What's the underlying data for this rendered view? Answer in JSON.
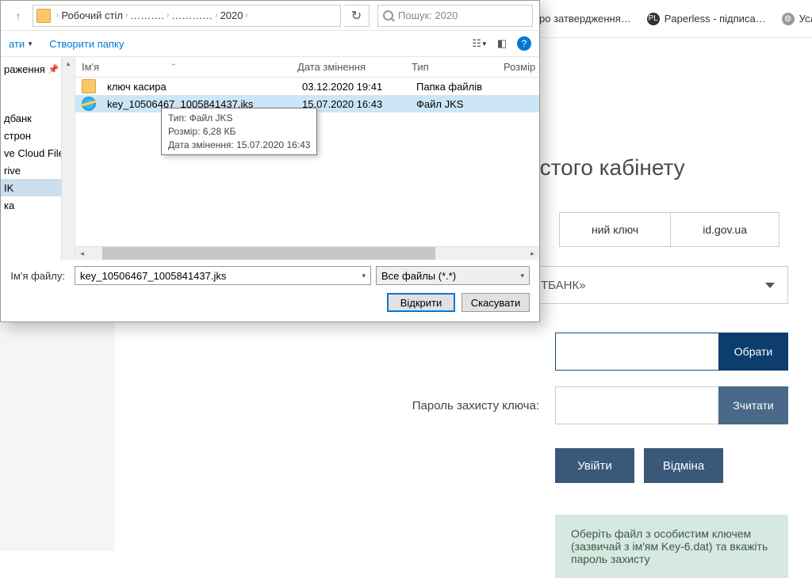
{
  "browser": {
    "bookmarks": [
      {
        "label": "ро затвердження…",
        "icon": "doc"
      },
      {
        "label": "Paperless - підписа…",
        "icon": "pl"
      },
      {
        "label": "Услуги",
        "icon": "globe"
      }
    ]
  },
  "page": {
    "title": "истого кабінету",
    "tab_key": "ний ключ",
    "tab_idgov": "id.gov.ua",
    "bank_dropdown": "ТБАНК»",
    "label_password": "Пароль захисту ключа:",
    "btn_select": "Обрати",
    "btn_read": "Зчитати",
    "btn_login": "Увійти",
    "btn_cancel": "Відміна",
    "info": "Оберіть файл з особистим ключем (зазвичай з ім'ям Key-6.dat) та вкажіть пароль захисту"
  },
  "dialog": {
    "breadcrumb": [
      "Робочий стіл",
      "……….",
      "…………",
      "2020"
    ],
    "search_placeholder": "Пошук: 2020",
    "toolbar": {
      "organize": "ати",
      "new_folder": "Створити папку"
    },
    "sidebar": {
      "items": [
        "раження",
        "дбанк",
        "строн",
        "ve Cloud File",
        "rive",
        "IK",
        "ка"
      ],
      "selected_index": 5,
      "pinned_index": 0
    },
    "columns": {
      "name": "Ім'я",
      "date": "Дата змінення",
      "type": "Тип",
      "size": "Розмір"
    },
    "rows": [
      {
        "icon": "folder",
        "name": "ключ касира",
        "date": "03.12.2020 19:41",
        "type": "Папка файлів",
        "size": ""
      },
      {
        "icon": "ie",
        "name": "key_10506467_1005841437.jks",
        "date": "15.07.2020 16:43",
        "type": "Файл JKS",
        "size": ""
      }
    ],
    "selected_row": 1,
    "tooltip": {
      "line1": "Тип: Файл JKS",
      "line2": "Розмір: 6,28 КБ",
      "line3": "Дата змінення: 15.07.2020 16:43"
    },
    "filename_label": "Ім'я файлу:",
    "filename_value": "key_10506467_1005841437.jks",
    "filter": "Все файлы (*.*)",
    "btn_open": "Відкрити",
    "btn_cancel": "Скасувати"
  }
}
